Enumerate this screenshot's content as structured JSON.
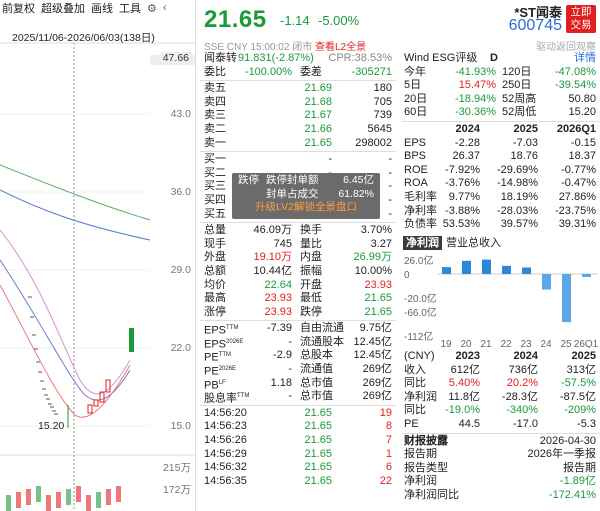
{
  "toolbar": {
    "items": [
      "前复权",
      "超级叠加",
      "画线",
      "工具"
    ],
    "settings_icon": "gear-icon"
  },
  "chart": {
    "range": "2025/11/06-2026/06/03(138日)",
    "price_ticks": [
      "47.66",
      "43.0",
      "36.0",
      "29.0",
      "22.0",
      "15.0"
    ],
    "low_label": "15.20",
    "vol_ticks": [
      "215万",
      "172万"
    ]
  },
  "quote": {
    "price": "21.65",
    "change": "-1.14",
    "change_pct": "-5.00%",
    "name": "*ST闻泰",
    "code": "600745",
    "trade_button": "立即交易",
    "subline": "SSE CNY 15:00:02 闭市",
    "l2_link": "查看L2全景",
    "subline_right": "驱动返回观察"
  },
  "left_rows": [
    {
      "l": "闻泰转",
      "v1": "91.831(-2.87%)",
      "l2": "CPR:38.53%",
      "c1": "green"
    },
    {
      "l": "委比",
      "v1": "-100.00%",
      "l2": "委差",
      "v2": "-305271",
      "c1": "green",
      "c2": "green"
    },
    {
      "sep": true
    },
    {
      "l": "卖五",
      "v1": "21.69",
      "v2": "180",
      "c1": "green"
    },
    {
      "l": "卖四",
      "v1": "21.68",
      "v2": "705",
      "c1": "green"
    },
    {
      "l": "卖三",
      "v1": "21.67",
      "v2": "739",
      "c1": "green"
    },
    {
      "l": "卖二",
      "v1": "21.66",
      "v2": "5645",
      "c1": "green"
    },
    {
      "l": "卖一",
      "v1": "21.65",
      "v2": "298002",
      "c1": "green"
    },
    {
      "sep": true
    },
    {
      "l": "买一",
      "v1": "-",
      "v2": "-"
    },
    {
      "l": "买二",
      "v1": "-",
      "v2": "-"
    },
    {
      "l": "买三",
      "v1": "-",
      "v2": "-"
    },
    {
      "l": "买四",
      "v1": "-",
      "v2": "-"
    },
    {
      "l": "买五",
      "v1": "-",
      "v2": "-"
    },
    {
      "sep": true
    },
    {
      "l": "总量",
      "v1": "46.09万",
      "l2": "换手",
      "v2": "3.70%"
    },
    {
      "l": "现手",
      "v1": "745",
      "l2": "量比",
      "v2": "3.27"
    },
    {
      "l": "外盘",
      "v1": "19.10万",
      "l2": "内盘",
      "v2": "26.99万",
      "c1": "red",
      "c2": "green"
    },
    {
      "l": "总额",
      "v1": "10.44亿",
      "l2": "振幅",
      "v2": "10.00%"
    },
    {
      "l": "均价",
      "v1": "22.64",
      "l2": "开盘",
      "v2": "23.93",
      "c1": "green",
      "c2": "red"
    },
    {
      "l": "最高",
      "v1": "23.93",
      "l2": "最低",
      "v2": "21.65",
      "c1": "red",
      "c2": "green"
    },
    {
      "l": "涨停",
      "v1": "23.93",
      "l2": "跌停",
      "v2": "21.65",
      "c1": "red",
      "c2": "green"
    },
    {
      "sep": true
    },
    {
      "l": "EPS",
      "sup": "TTM",
      "v1": "-7.39",
      "l2": "自由流通",
      "v2": "9.75亿"
    },
    {
      "l": "EPS",
      "sup": "2026E",
      "v1": "-",
      "l2": "流通股本",
      "v2": "12.45亿"
    },
    {
      "l": "PE",
      "sup": "TTM",
      "v1": "-2.9",
      "l2": "总股本",
      "v2": "12.45亿"
    },
    {
      "l": "PE",
      "sup": "2026E",
      "v1": "-",
      "l2": "流通值",
      "v2": "269亿"
    },
    {
      "l": "PB",
      "sup": "LF",
      "v1": "1.18",
      "l2": "总市值",
      "v2": "269亿"
    },
    {
      "l": "股息率",
      "sup": "TTM",
      "v1": "-",
      "l2": "总市值",
      "v2": "269亿"
    },
    {
      "sep": true
    },
    {
      "l": "14:56:20",
      "v1": "21.65",
      "v2": "19",
      "c1": "green",
      "c2": "red"
    },
    {
      "l": "14:56:23",
      "v1": "21.65",
      "v2": "8",
      "c1": "green",
      "c2": "red"
    },
    {
      "l": "14:56:26",
      "v1": "21.65",
      "v2": "7",
      "c1": "green",
      "c2": "red"
    },
    {
      "l": "14:56:29",
      "v1": "21.65",
      "v2": "1",
      "c1": "green",
      "c2": "red"
    },
    {
      "l": "14:56:32",
      "v1": "21.65",
      "v2": "6",
      "c1": "green",
      "c2": "red"
    },
    {
      "l": "14:56:35",
      "v1": "21.65",
      "v2": "22",
      "c1": "green",
      "c2": "red"
    }
  ],
  "overlay": {
    "r1_label": "跌停",
    "r1_mid": "跌停封单额",
    "r1_val": "6.45亿",
    "r2_mid": "封单占成交",
    "r2_val": "61.82%",
    "cta": "升级LV2解锁全景盘口"
  },
  "right_top": {
    "esg_label": "Wind ESG评级",
    "esg_grade": "D",
    "detail": "详情",
    "perf": [
      {
        "l": "今年",
        "v": "-41.93%",
        "l2": "120日",
        "v2": "-47.08%",
        "c": "green",
        "c2": "green"
      },
      {
        "l": "5日",
        "v": "15.47%",
        "l2": "250日",
        "v2": "-39.54%",
        "c": "red",
        "c2": "green"
      },
      {
        "l": "20日",
        "v": "-18.94%",
        "l2": "52周高",
        "v2": "50.80",
        "c": "green"
      },
      {
        "l": "60日",
        "v": "-30.36%",
        "l2": "52周低",
        "v2": "15.20",
        "c": "green"
      }
    ],
    "years": [
      "2024",
      "2025",
      "2026Q1"
    ],
    "fin": [
      {
        "l": "EPS",
        "v": [
          "-2.28",
          "-7.03",
          "-0.15"
        ]
      },
      {
        "l": "BPS",
        "v": [
          "26.37",
          "18.76",
          "18.37"
        ]
      },
      {
        "l": "ROE",
        "v": [
          "-7.92%",
          "-29.69%",
          "-0.77%"
        ]
      },
      {
        "l": "ROA",
        "v": [
          "-3.76%",
          "-14.98%",
          "-0.47%"
        ]
      },
      {
        "l": "毛利率",
        "v": [
          "9.77%",
          "18.19%",
          "27.86%"
        ]
      },
      {
        "l": "净利率",
        "v": [
          "-3.88%",
          "-28.03%",
          "-23.75%"
        ]
      },
      {
        "l": "负债率",
        "v": [
          "53.53%",
          "39.57%",
          "39.31%"
        ]
      }
    ]
  },
  "tabs": {
    "profit": "净利润",
    "revenue": "营业总收入"
  },
  "bars": {
    "y_ticks": [
      "26.0亿",
      "0",
      "-20.0亿",
      "-66.0亿",
      "-112亿"
    ],
    "x_labels": [
      "19",
      "20",
      "21",
      "22",
      "23",
      "24",
      "25",
      "26Q1"
    ],
    "annual": [
      12.5,
      24.0,
      26.1,
      14.8,
      11.8,
      -28.3,
      -87.5
    ]
  },
  "fin_bottom": {
    "header": [
      "(CNY)",
      "2023",
      "2024",
      "2025"
    ],
    "rows": [
      {
        "l": "收入",
        "v": [
          "612亿",
          "736亿",
          "313亿"
        ]
      },
      {
        "l": "同比",
        "v": [
          "5.40%",
          "20.2%",
          "-57.5%"
        ],
        "c": [
          "red",
          "red",
          "green"
        ]
      },
      {
        "l": "净利润",
        "v": [
          "11.8亿",
          "-28.3亿",
          "-87.5亿"
        ]
      },
      {
        "l": "同比",
        "v": [
          "-19.0%",
          "-340%",
          "-209%"
        ],
        "c": [
          "green",
          "green",
          "green"
        ]
      },
      {
        "l": "PE",
        "v": [
          "44.5",
          "-17.0",
          "-5.3"
        ]
      }
    ],
    "report_title": "财报披露",
    "report_date": "2026-04-30",
    "report_rows": [
      {
        "l": "报告期",
        "v": "2026年一季报"
      },
      {
        "l": "报告类型",
        "v": "报告期"
      },
      {
        "l": "净利润",
        "v": "-1.89亿",
        "c": "green"
      },
      {
        "l": "净利润同比",
        "v": "-172.41%",
        "c": "green"
      }
    ]
  }
}
